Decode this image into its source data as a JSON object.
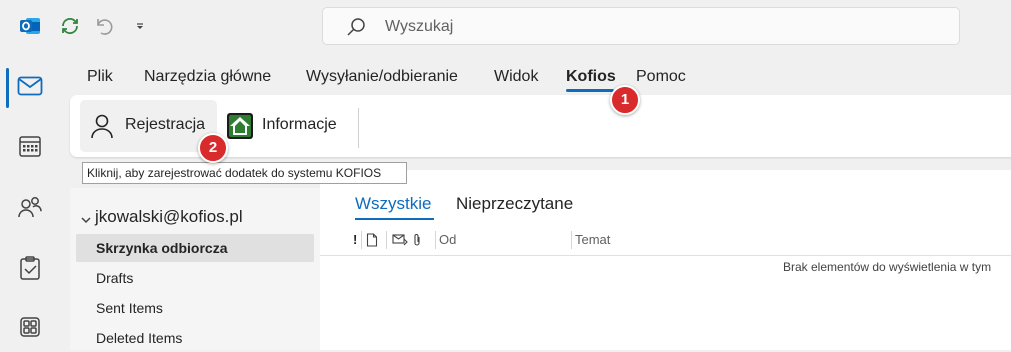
{
  "titlebar": {
    "app_icon": "outlook-logo-icon",
    "sync_icon": "sync-icon",
    "undo_icon": "undo-icon",
    "customize_icon": "chevron-down-icon",
    "search_placeholder": "Wyszukaj"
  },
  "rail": {
    "items": [
      "mail-icon",
      "calendar-icon",
      "people-icon",
      "tasks-icon",
      "apps-icon"
    ],
    "active": "mail-icon"
  },
  "menu": {
    "tabs": [
      "Plik",
      "Narzędzia główne",
      "Wysyłanie/odbieranie",
      "Widok",
      "Kofios",
      "Pomoc"
    ],
    "active": "Kofios"
  },
  "ribbon": {
    "buttons": [
      {
        "label": "Rejestracja",
        "icon": "person-icon"
      },
      {
        "label": "Informacje",
        "icon": "kofios-home-icon"
      }
    ]
  },
  "tooltip": {
    "text": "Kliknij, aby zarejestrować dodatek do systemu KOFIOS"
  },
  "badges": [
    "1",
    "2"
  ],
  "folders": {
    "account": "jkowalski@kofios.pl",
    "items": [
      "Skrzynka odbiorcza",
      "Drafts",
      "Sent Items",
      "Deleted Items"
    ],
    "selected": "Skrzynka odbiorcza"
  },
  "message_list": {
    "tabs": [
      "Wszystkie",
      "Nieprzeczytane"
    ],
    "active_tab": "Wszystkie",
    "columns": {
      "importance": "!",
      "from": "Od",
      "subject": "Temat"
    },
    "empty_text": "Brak elementów do wyświetlenia w tym"
  },
  "colors": {
    "accent": "#0f6cbd",
    "badge": "#d92b2b",
    "kofios_icon_bg": "#2e7d32"
  }
}
